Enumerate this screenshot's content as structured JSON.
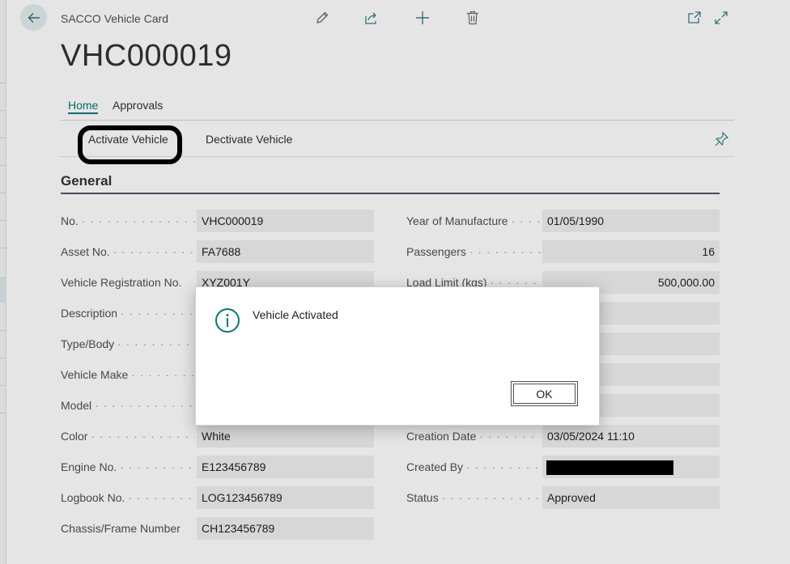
{
  "header": {
    "caption": "SACCO Vehicle Card",
    "record_id": "VHC000019"
  },
  "icons": {
    "back": "arrow-left-icon",
    "edit": "pencil-icon",
    "share": "share-icon",
    "new": "plus-icon",
    "delete": "trash-icon",
    "open_new_window": "open-in-new-window-icon",
    "expand": "expand-icon",
    "pin": "pin-icon",
    "info": "info-icon"
  },
  "tabs": [
    "Home",
    "Approvals"
  ],
  "actions": {
    "activate": "Activate Vehicle",
    "deactivate": "Dectivate Vehicle"
  },
  "section": {
    "title": "General"
  },
  "fields_left": [
    {
      "label": "No.",
      "value": "VHC000019"
    },
    {
      "label": "Asset No.",
      "value": "FA7688"
    },
    {
      "label": "Vehicle Registration No.",
      "value": "XYZ001Y"
    },
    {
      "label": "Description",
      "value": ""
    },
    {
      "label": "Type/Body",
      "value": ""
    },
    {
      "label": "Vehicle Make",
      "value": ""
    },
    {
      "label": "Model",
      "value": ""
    },
    {
      "label": "Color",
      "value": "White"
    },
    {
      "label": "Engine No.",
      "value": "E123456789"
    },
    {
      "label": "Logbook No.",
      "value": "LOG123456789"
    },
    {
      "label": "Chassis/Frame Number",
      "value": "CH123456789"
    }
  ],
  "fields_right": [
    {
      "label": "Year of Manufacture",
      "value": "01/05/1990"
    },
    {
      "label": "Passengers",
      "value": "16"
    },
    {
      "label": "Load Limit (kgs)",
      "value": "500,000.00"
    },
    {
      "label": "",
      "value": ""
    },
    {
      "label": "",
      "value": ""
    },
    {
      "label": "",
      "value": ""
    },
    {
      "label": "",
      "value": ""
    },
    {
      "label": "Creation Date",
      "value": "03/05/2024 11:10"
    },
    {
      "label": "Created By",
      "value": ""
    },
    {
      "label": "Status",
      "value": "Approved"
    }
  ],
  "dialog": {
    "message": "Vehicle Activated",
    "ok_label": "OK"
  },
  "colors": {
    "accent": "#007a7a",
    "section_line": "#4d5666",
    "field_bg": "#f0f0f0"
  }
}
